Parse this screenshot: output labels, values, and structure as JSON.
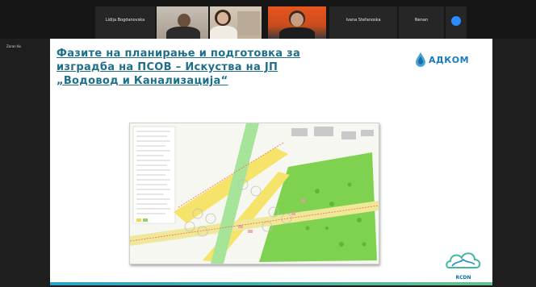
{
  "gallery": {
    "participants": [
      {
        "name": "Lidija Bogdanovska"
      },
      {
        "name": "Ivana Stefanoska"
      },
      {
        "name": "Nenan"
      }
    ],
    "left_label": "Zoran Ko"
  },
  "slide": {
    "title": "Фазите на планирање и подготовка за\nизградба на ПСОВ  – Искуства на ЈП\n„Водовод и Канализација“",
    "brand": "АДКОМ",
    "rcdn_label": "RCDN"
  },
  "colors": {
    "title": "#1f6f8b",
    "brand": "#1a7bbf",
    "zoom_blue": "#2d8cff"
  },
  "icons": [
    "water-drop-icon",
    "rcdn-logo-icon",
    "participant-avatar-icon"
  ]
}
